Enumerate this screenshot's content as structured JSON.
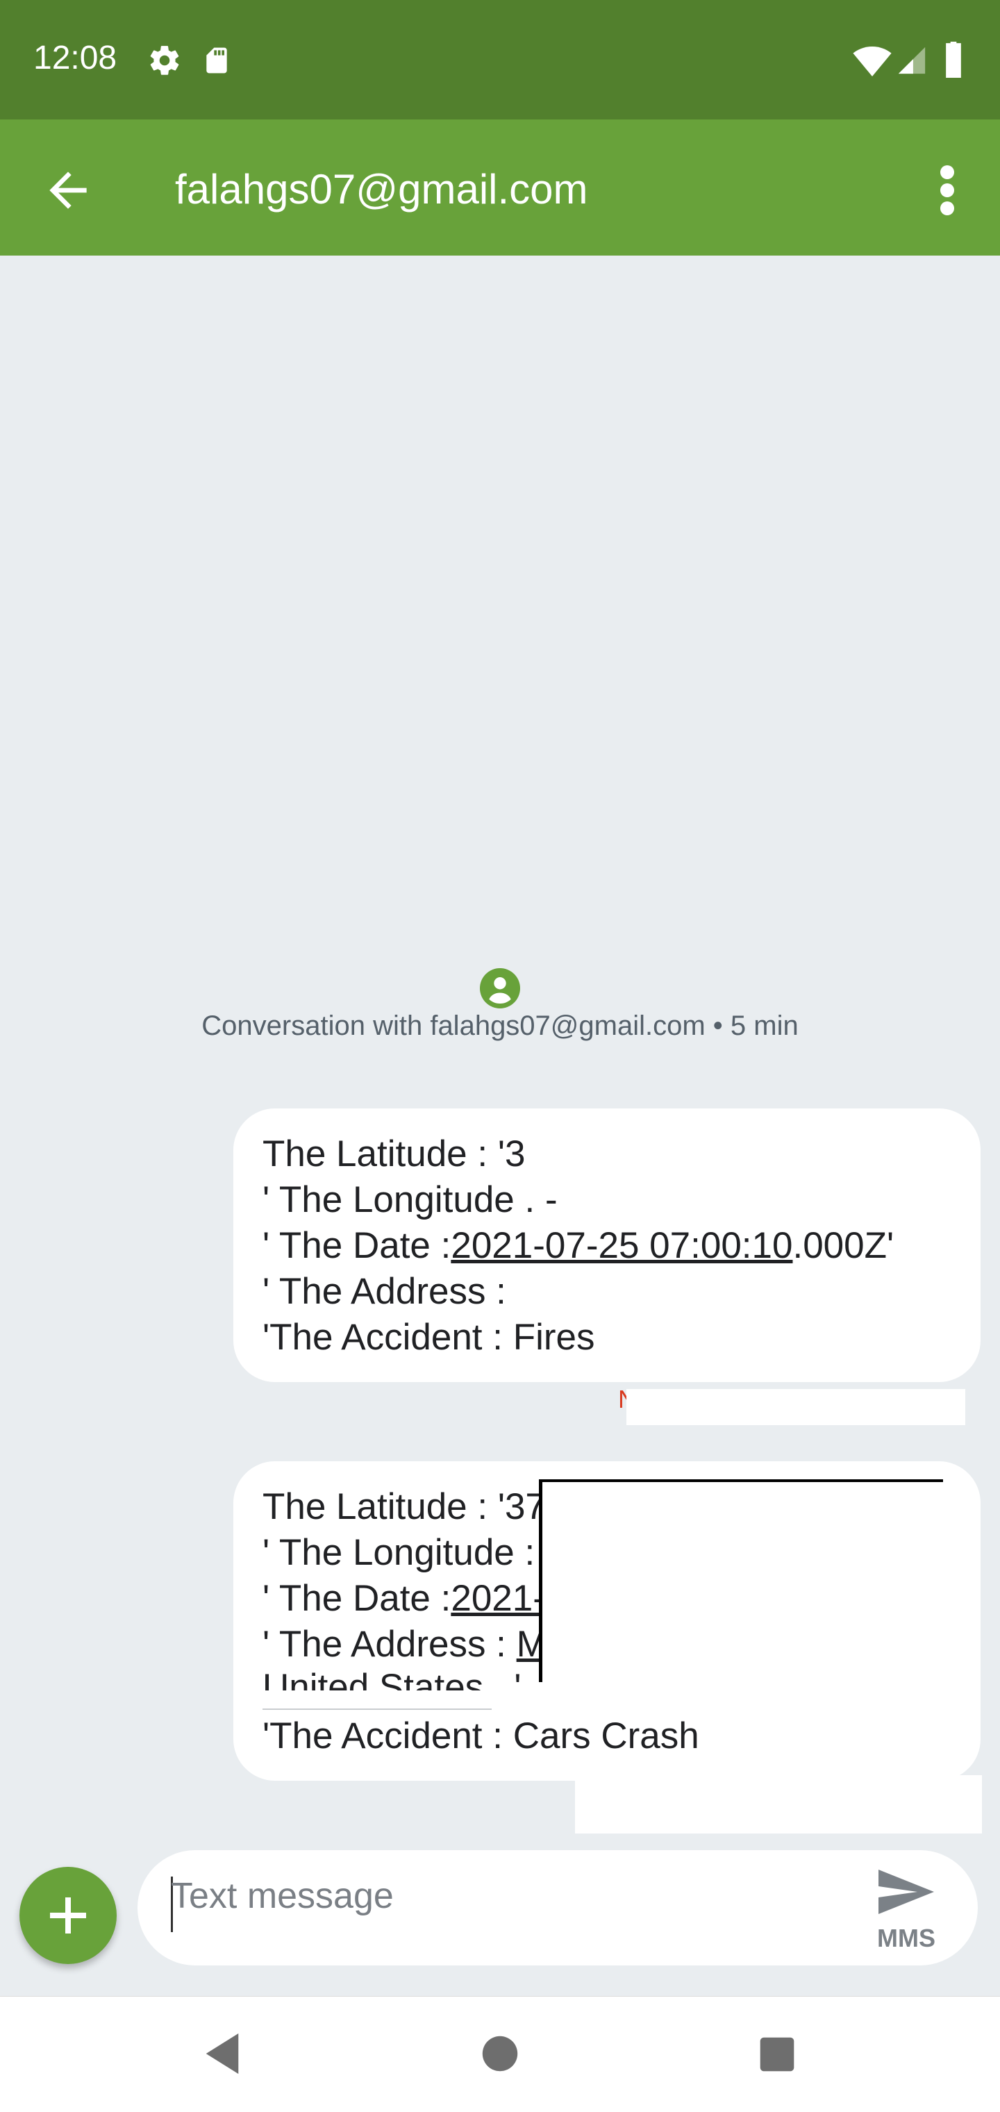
{
  "status_bar": {
    "time": "12:08",
    "icons": [
      "settings-icon",
      "sd-card-icon",
      "wifi-icon",
      "signal-icon",
      "battery-icon"
    ]
  },
  "toolbar": {
    "title": "falahgs07@gmail.com",
    "back_icon": "arrow-back-icon",
    "menu_icon": "more-vert-icon"
  },
  "conversation": {
    "info": "Conversation with falahgs07@gmail.com • 5 min"
  },
  "messages": [
    {
      "lines": [
        "The Latitude : '3",
        "' The Longitude . -",
        "' The Date :",
        "' The Address :",
        "'The Accident  : Fires"
      ],
      "date_underlined": "2021-07-25 07:00:10",
      "date_suffix": ".000Z'",
      "status_fragment": "N"
    },
    {
      "lines": [
        "The Latitude : '37",
        "' The Longitude :",
        "' The Date :",
        "' The Address :",
        "United States . '",
        "'The Accident  : Cars Crash"
      ],
      "date_underlined": "2021-",
      "address_fragment": "M"
    }
  ],
  "composer": {
    "placeholder": "Text message",
    "send_label": "MMS"
  },
  "colors": {
    "status_bar": "#52802D",
    "toolbar": "#68A23A",
    "background": "#E9EDF0",
    "accent": "#68A23A"
  }
}
